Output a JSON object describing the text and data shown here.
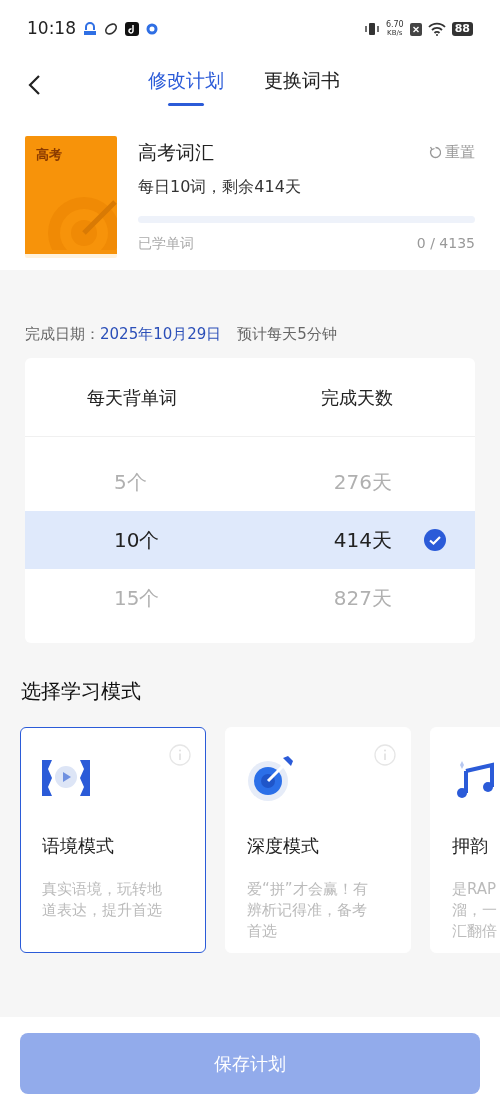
{
  "status_bar": {
    "time": "10:18",
    "speed_value": "6.70",
    "speed_unit": "KB/s",
    "battery": "88"
  },
  "tabs": [
    {
      "label": "修改计划",
      "selected": true
    },
    {
      "label": "更换词书",
      "selected": false
    }
  ],
  "book": {
    "cover_label": "高考",
    "title": "高考词汇",
    "summary": "每日10词，剩余414天",
    "reset": "重置",
    "progress_label": "已学单词",
    "progress_count": "0 / 4135",
    "level": 0
  },
  "plan": {
    "date_label": "完成日期：",
    "date": "2025年10月29日",
    "estimate": "预计每天5分钟"
  },
  "picker": {
    "columns": [
      "每天背单词",
      "完成天数"
    ],
    "rows": [
      {
        "words": "5个",
        "days": "276天",
        "selected": false
      },
      {
        "words": "10个",
        "days": "414天",
        "selected": true
      },
      {
        "words": "15个",
        "days": "827天",
        "selected": false
      }
    ]
  },
  "modes": {
    "title": "选择学习模式",
    "cards": [
      {
        "kind": "context",
        "title": "语境模式",
        "lines": [
          "真实语境，玩转地",
          "道表达，提升首选"
        ],
        "selected": true,
        "info": true
      },
      {
        "kind": "target",
        "title": "深度模式",
        "lines": [
          "爱“拼”才会赢！有",
          "辨析记得准，备考",
          "首选"
        ],
        "selected": false,
        "info": true
      },
      {
        "kind": "music",
        "title": "押韵",
        "lines": [
          "是RAP",
          "溜，一",
          "汇翻倍"
        ],
        "selected": false
      }
    ]
  },
  "save_button": {
    "label": "保存计划",
    "disabled": true
  }
}
